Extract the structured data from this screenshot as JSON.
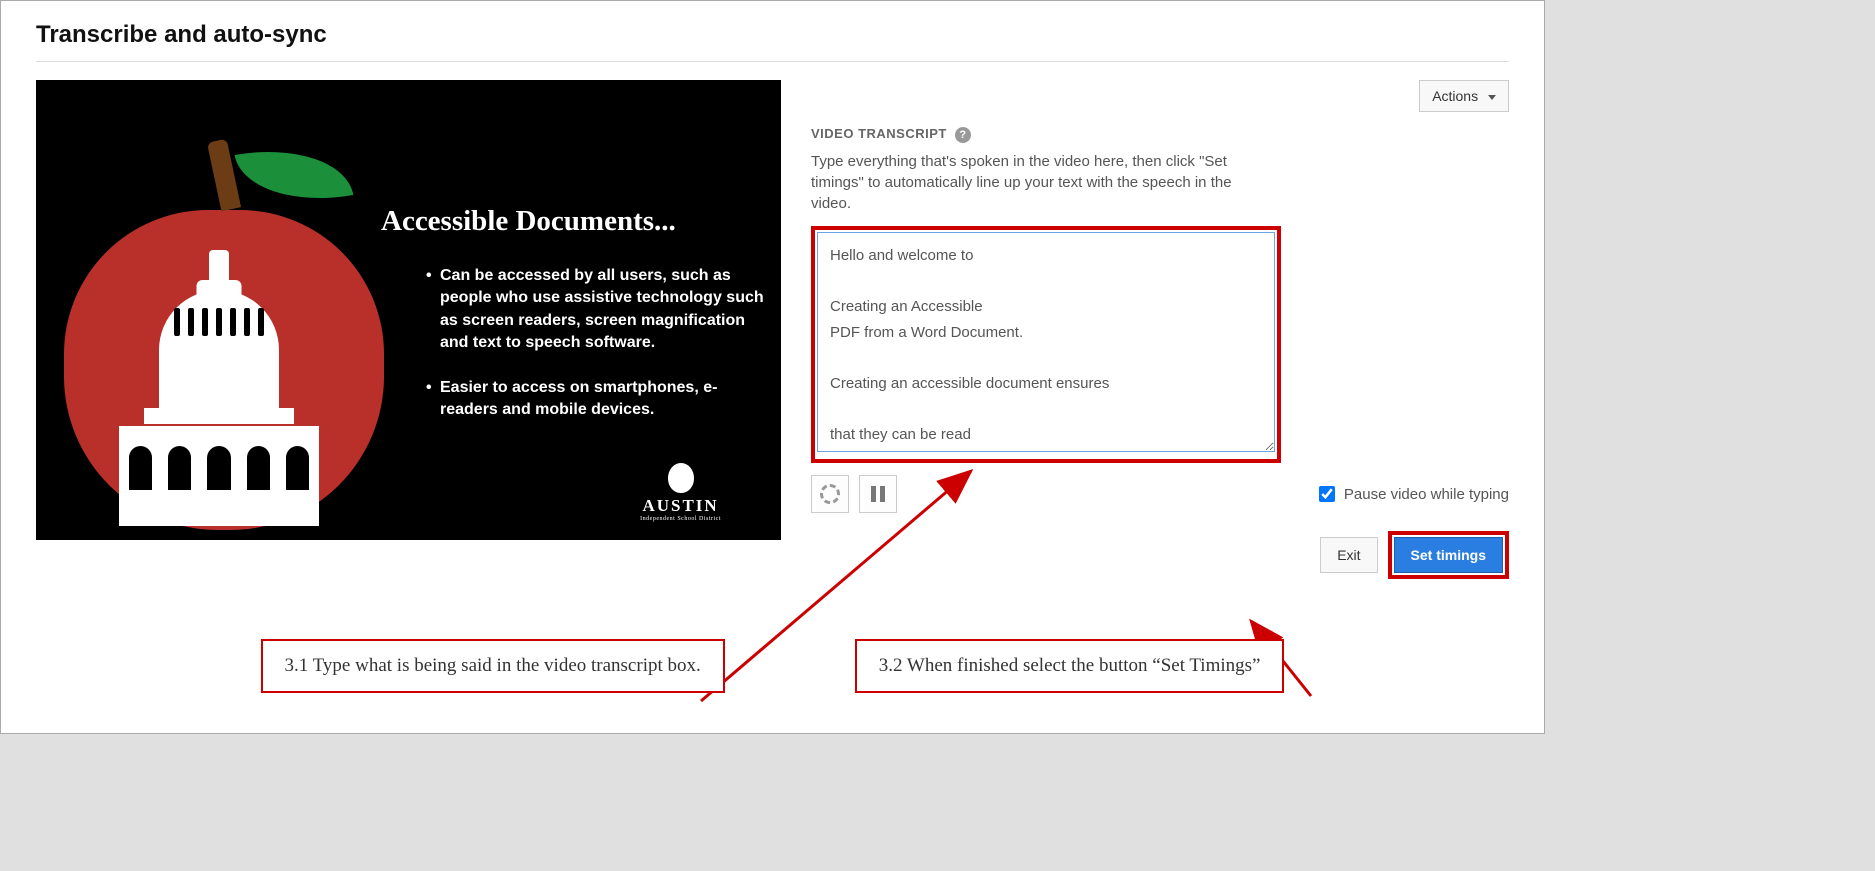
{
  "page": {
    "title": "Transcribe and auto-sync"
  },
  "actions": {
    "label": "Actions"
  },
  "video": {
    "title": "Accessible Documents...",
    "bullet1": "Can be accessed by all users, such as people who use assistive technology such as screen readers, screen magnification and text to speech software.",
    "bullet2": "Easier to access on smartphones, e-readers and mobile devices.",
    "logo_label": "AUSTIN",
    "logo_sub": "Independent School District"
  },
  "transcript": {
    "section_label": "VIDEO TRANSCRIPT",
    "help_symbol": "?",
    "description": "Type everything that's spoken in the video here, then click \"Set timings\" to automatically line up your text with the speech in the video.",
    "content": "Hello and welcome to\n\nCreating an Accessible\nPDF from a Word Document.\n\nCreating an accessible document ensures\n\nthat they can be read\nby a variety of users"
  },
  "controls": {
    "pause_label": "Pause video while typing",
    "pause_checked": true
  },
  "buttons": {
    "exit": "Exit",
    "set_timings": "Set timings"
  },
  "annotations": {
    "callout1": "3.1 Type what is being said in the video transcript box.",
    "callout2": "3.2 When finished select the button “Set Timings”"
  }
}
